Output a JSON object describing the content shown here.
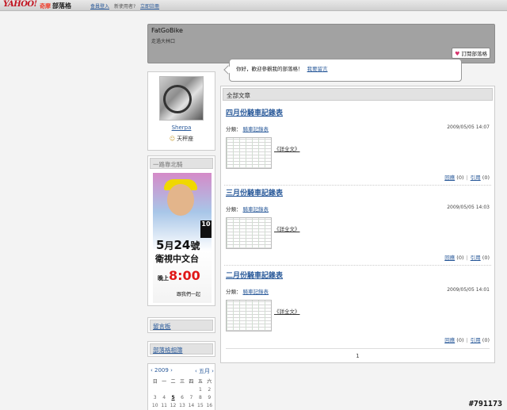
{
  "topbar": {
    "logo": "YAHOO!",
    "logo_sub": "奇摩",
    "blog_label": "部落格",
    "links": [
      "會員登入",
      "新使用者?",
      "立即註冊"
    ]
  },
  "header": {
    "title": "FatGoBike",
    "subtitle": "走過大林口",
    "subscribe_label": "訂閱部落格"
  },
  "bubble": {
    "message": "你好，歡迎參觀我的部落格！",
    "link": "我要留言"
  },
  "profile": {
    "name": "Sherpa",
    "zodiac": "天秤座"
  },
  "poster_panel": {
    "title": "一路靠北騎",
    "poster": {
      "date_month": "5",
      "date_suffix": "月",
      "date_day": "24",
      "date_day_suffix": "號",
      "channel": "衛視中文台",
      "time_prefix": "晚上",
      "time": "8:00",
      "join": "跟我們一起",
      "badge": "10"
    }
  },
  "sidebar_links": {
    "guestbook": "留言板",
    "album": "部落格相簿"
  },
  "calendar": {
    "prev": "‹ 2009 ›",
    "next": "‹ 五月 ›",
    "days_of_week": [
      "日",
      "一",
      "二",
      "三",
      "四",
      "五",
      "六"
    ],
    "dates": [
      "",
      "",
      "",
      "",
      "",
      "1",
      "2",
      "3",
      "4",
      "5",
      "6",
      "7",
      "8",
      "9",
      "10",
      "11",
      "12",
      "13",
      "14",
      "15",
      "16"
    ],
    "highlight_date": "5"
  },
  "main": {
    "header": "全部文章",
    "category_label": "分類：",
    "reply_label": "回應",
    "quote_label": "引用",
    "posts": [
      {
        "title": "四月份騎車記錄表",
        "category": "騎車記錄表",
        "date": "2009/05/05 14:07",
        "more": "《詳全文》",
        "replies": "(0)",
        "quotes": "(0)"
      },
      {
        "title": "三月份騎車記錄表",
        "category": "騎車記錄表",
        "date": "2009/05/05 14:03",
        "more": "《詳全文》",
        "replies": "(0)",
        "quotes": "(0)"
      },
      {
        "title": "二月份騎車記錄表",
        "category": "騎車記錄表",
        "date": "2009/05/05 14:01",
        "more": "《詳全文》",
        "replies": "(0)",
        "quotes": "(0)"
      }
    ],
    "page": "1"
  },
  "watermark": "#791173"
}
